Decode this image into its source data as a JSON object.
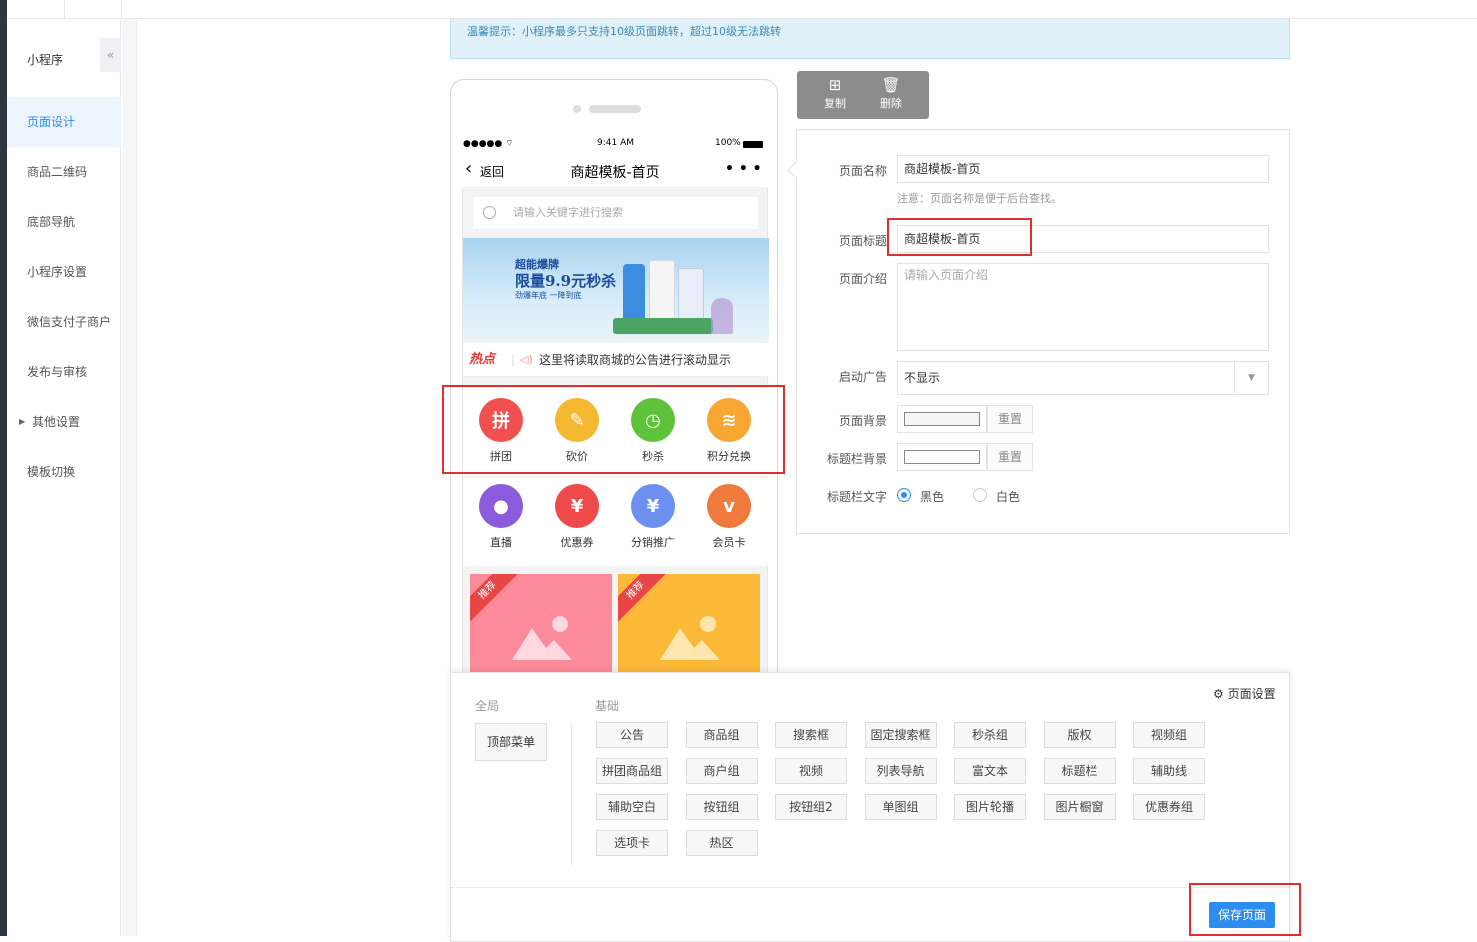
{
  "sidebar": {
    "title": "小程序",
    "collapse": "«",
    "items": [
      {
        "label": "页面设计"
      },
      {
        "label": "商品二维码"
      },
      {
        "label": "底部导航"
      },
      {
        "label": "小程序设置"
      },
      {
        "label": "微信支付子商户"
      },
      {
        "label": "发布与审核"
      },
      {
        "label": "其他设置"
      },
      {
        "label": "模板切换"
      }
    ]
  },
  "notice": "温馨提示：小程序最多只支持10级页面跳转，超过10级无法跳转",
  "phone": {
    "status_signal": "●●●●● ⌔",
    "status_time": "9:41 AM",
    "status_battery": "100%",
    "back_label": "返回",
    "nav_title": "商超模板-首页",
    "more": "• • •",
    "search_placeholder": "请输入关键字进行搜索",
    "banner_line1": "超能爆牌",
    "banner_line2": "限量9.9元秒杀",
    "banner_line3": "劲爆年底 一降到底",
    "announce_tag": "热点",
    "announce_text": "这里将读取商城的公告进行滚动显示",
    "row1": [
      {
        "label": "拼团",
        "glyph": "拼",
        "color": "#f0504f"
      },
      {
        "label": "砍价",
        "glyph": "✎",
        "color": "#f5b931"
      },
      {
        "label": "秒杀",
        "glyph": "◷",
        "color": "#5ec33a"
      },
      {
        "label": "积分兑换",
        "glyph": "≋",
        "color": "#f8a632"
      }
    ],
    "row2": [
      {
        "label": "直播",
        "glyph": "●",
        "color": "#8a5bdb"
      },
      {
        "label": "优惠券",
        "glyph": "¥",
        "color": "#ef4a4a"
      },
      {
        "label": "分销推广",
        "glyph": "¥",
        "color": "#6d8ff0"
      },
      {
        "label": "会员卡",
        "glyph": "v",
        "color": "#f07a3c"
      }
    ],
    "goods_tag": "推荐"
  },
  "actions": {
    "copy": "复制",
    "delete": "删除"
  },
  "form": {
    "name_label": "页面名称",
    "name_value": "商超模板-首页",
    "name_hint": "注意：页面名称是便于后台查找。",
    "title_label": "页面标题",
    "title_value": "商超模板-首页",
    "intro_label": "页面介绍",
    "intro_placeholder": "请输入页面介绍",
    "ad_label": "启动广告",
    "ad_value": "不显示",
    "bg_label": "页面背景",
    "titlebar_bg_label": "标题栏背景",
    "reset": "重置",
    "titlebar_text_label": "标题栏文字",
    "opt_black": "黑色",
    "opt_white": "白色"
  },
  "panel": {
    "global_label": "全局",
    "basic_label": "基础",
    "top_menu": "顶部菜单",
    "page_settings": "页面设置",
    "components": [
      "公告",
      "商品组",
      "搜索框",
      "固定搜索框",
      "秒杀组",
      "版权",
      "视频组",
      "拼团商品组",
      "商户组",
      "视频",
      "列表导航",
      "富文本",
      "标题栏",
      "辅助线",
      "辅助空白",
      "按钮组",
      "按钮组2",
      "单图组",
      "图片轮播",
      "图片橱窗",
      "优惠券组",
      "选项卡",
      "热区"
    ],
    "save": "保存页面"
  }
}
